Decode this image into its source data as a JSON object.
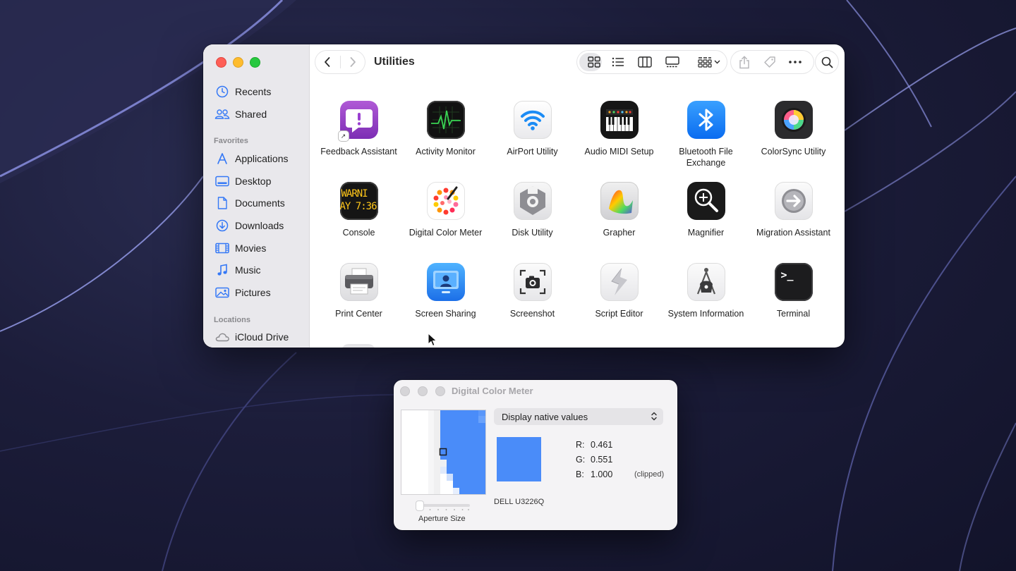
{
  "finder": {
    "title": "Utilities",
    "sidebar": {
      "top_items": [
        {
          "label": "Recents",
          "icon": "clock-icon"
        },
        {
          "label": "Shared",
          "icon": "people-icon"
        }
      ],
      "favorites_header": "Favorites",
      "favorites": [
        {
          "label": "Applications",
          "icon": "applications-icon"
        },
        {
          "label": "Desktop",
          "icon": "desktop-icon"
        },
        {
          "label": "Documents",
          "icon": "document-icon"
        },
        {
          "label": "Downloads",
          "icon": "download-icon"
        },
        {
          "label": "Movies",
          "icon": "film-icon"
        },
        {
          "label": "Music",
          "icon": "music-note-icon"
        },
        {
          "label": "Pictures",
          "icon": "photo-icon"
        }
      ],
      "locations_header": "Locations",
      "locations": [
        {
          "label": "iCloud Drive",
          "icon": "cloud-icon"
        }
      ]
    },
    "apps": [
      {
        "label": "Feedback Assistant",
        "icon": "feedback-assistant-icon"
      },
      {
        "label": "Activity Monitor",
        "icon": "activity-monitor-icon"
      },
      {
        "label": "AirPort Utility",
        "icon": "airport-utility-icon"
      },
      {
        "label": "Audio MIDI Setup",
        "icon": "audio-midi-setup-icon"
      },
      {
        "label": "Bluetooth File Exchange",
        "icon": "bluetooth-icon"
      },
      {
        "label": "ColorSync Utility",
        "icon": "colorsync-icon"
      },
      {
        "label": "Console",
        "icon": "console-icon"
      },
      {
        "label": "Digital Color Meter",
        "icon": "digital-color-meter-icon"
      },
      {
        "label": "Disk Utility",
        "icon": "disk-utility-icon"
      },
      {
        "label": "Grapher",
        "icon": "grapher-icon"
      },
      {
        "label": "Magnifier",
        "icon": "magnifier-icon"
      },
      {
        "label": "Migration Assistant",
        "icon": "migration-assistant-icon"
      },
      {
        "label": "Print Center",
        "icon": "printer-icon"
      },
      {
        "label": "Screen Sharing",
        "icon": "screen-sharing-icon"
      },
      {
        "label": "Screenshot",
        "icon": "screenshot-icon"
      },
      {
        "label": "Script Editor",
        "icon": "script-editor-icon"
      },
      {
        "label": "System Information",
        "icon": "system-information-icon"
      },
      {
        "label": "Terminal",
        "icon": "terminal-icon"
      }
    ],
    "console_icon_text": [
      "WARNI",
      "AY 7:36"
    ],
    "terminal_icon_text": ">_"
  },
  "color_meter": {
    "title": "Digital Color Meter",
    "mode": "Display native values",
    "r_label": "R:",
    "r_value": "0.461",
    "g_label": "G:",
    "g_value": "0.551",
    "b_label": "B:",
    "b_value": "1.000",
    "clipped": "(clipped)",
    "display_name": "DELL U3226Q",
    "aperture_label": "Aperture Size",
    "sampled_color": "#4a8cf9"
  }
}
